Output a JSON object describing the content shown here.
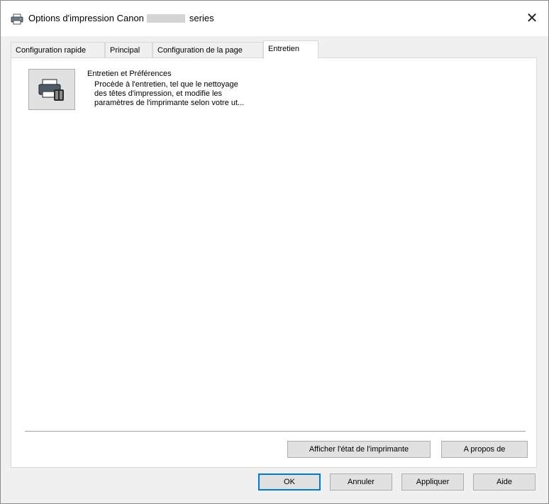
{
  "window": {
    "title_prefix": "Options d'impression Canon",
    "title_suffix": "series",
    "close_glyph": "✕"
  },
  "tabs": [
    {
      "label": "Configuration rapide",
      "active": false
    },
    {
      "label": "Principal",
      "active": false
    },
    {
      "label": "Configuration de la page",
      "active": false
    },
    {
      "label": "Entretien",
      "active": true
    }
  ],
  "maintenance": {
    "icon": "printer-maintenance-icon",
    "title": "Entretien et Préférences",
    "description_lines": [
      "Procède à l'entretien, tel que le nettoyage",
      "des têtes d'impression, et modifie les",
      "paramètres de l'imprimante selon votre ut..."
    ]
  },
  "panel_buttons": {
    "status_label": "Afficher l'état de l'imprimante",
    "about_label": "A propos de"
  },
  "dialog_buttons": {
    "ok_label": "OK",
    "cancel_label": "Annuler",
    "apply_label": "Appliquer",
    "help_label": "Aide"
  },
  "colors": {
    "default_button_border": "#0078d7",
    "window_background": "#f0f0f0",
    "panel_background": "#ffffff"
  }
}
